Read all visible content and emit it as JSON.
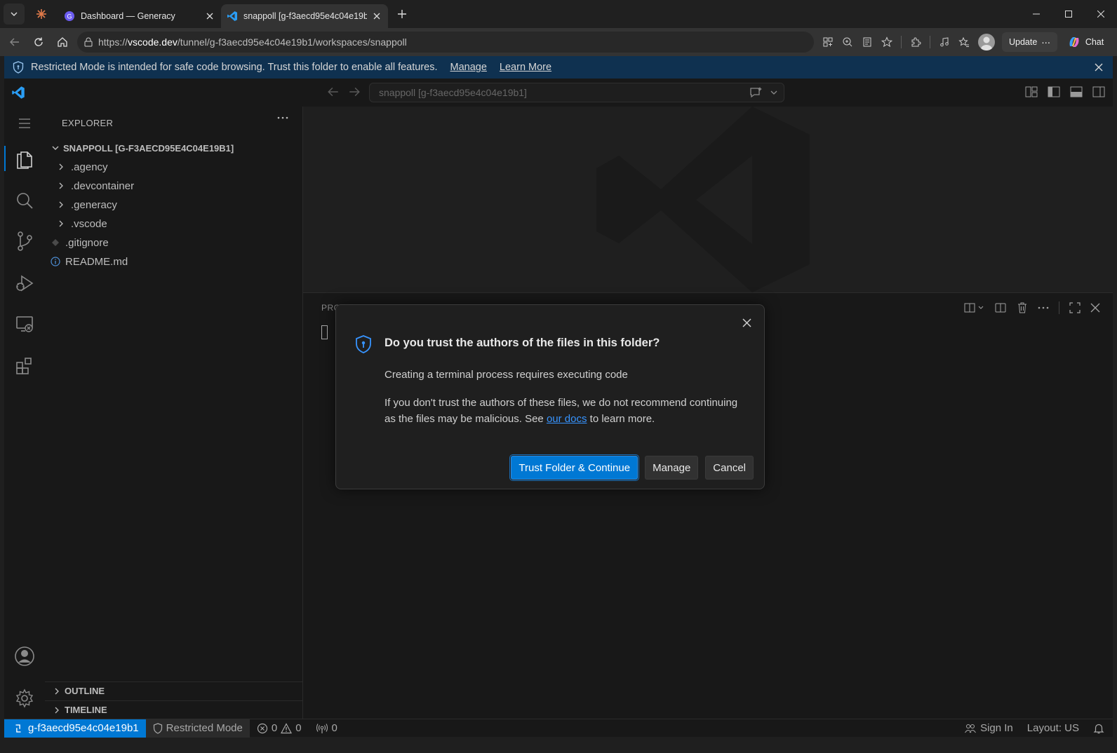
{
  "browser": {
    "tabs": [
      {
        "title": "Dashboard — Generacy",
        "active": false
      },
      {
        "title": "snappoll [g-f3aecd95e4c04e19b1]",
        "active": true
      }
    ],
    "url_prefix": "https://",
    "url_host": "vscode.dev",
    "url_path": "/tunnel/g-f3aecd95e4c04e19b1/workspaces/snappoll",
    "update_label": "Update",
    "chat_label": "Chat"
  },
  "banner": {
    "text": "Restricted Mode is intended for safe code browsing. Trust this folder to enable all features.",
    "manage_label": "Manage",
    "learn_more_label": "Learn More"
  },
  "titlebar": {
    "command_center": "snappoll [g-f3aecd95e4c04e19b1]"
  },
  "explorer": {
    "header": "EXPLORER",
    "root_folder": "SNAPPOLL [G-F3AECD95E4C04E19B1]",
    "items": [
      {
        "name": ".agency",
        "type": "folder"
      },
      {
        "name": ".devcontainer",
        "type": "folder"
      },
      {
        "name": ".generacy",
        "type": "folder"
      },
      {
        "name": ".vscode",
        "type": "folder"
      },
      {
        "name": ".gitignore",
        "type": "file"
      },
      {
        "name": "README.md",
        "type": "file"
      }
    ],
    "outline_label": "OUTLINE",
    "timeline_label": "TIMELINE"
  },
  "panel": {
    "title_visible": "PRO"
  },
  "dialog": {
    "title": "Do you trust the authors of the files in this folder?",
    "detail": "Creating a terminal process requires executing code",
    "message_before": "If you don't trust the authors of these files, we do not recommend continuing as the files may be malicious. See ",
    "message_link": "our docs",
    "message_after": " to learn more.",
    "buttons": {
      "trust": "Trust Folder & Continue",
      "manage": "Manage",
      "cancel": "Cancel"
    }
  },
  "statusbar": {
    "remote": "g-f3aecd95e4c04e19b1",
    "restricted": "Restricted Mode",
    "errors": "0",
    "warnings": "0",
    "ports": "0",
    "sign_in": "Sign In",
    "layout": "Layout: US"
  },
  "colors": {
    "accent": "#0078d4",
    "banner_bg": "#0f3150",
    "link": "#3794ff"
  }
}
